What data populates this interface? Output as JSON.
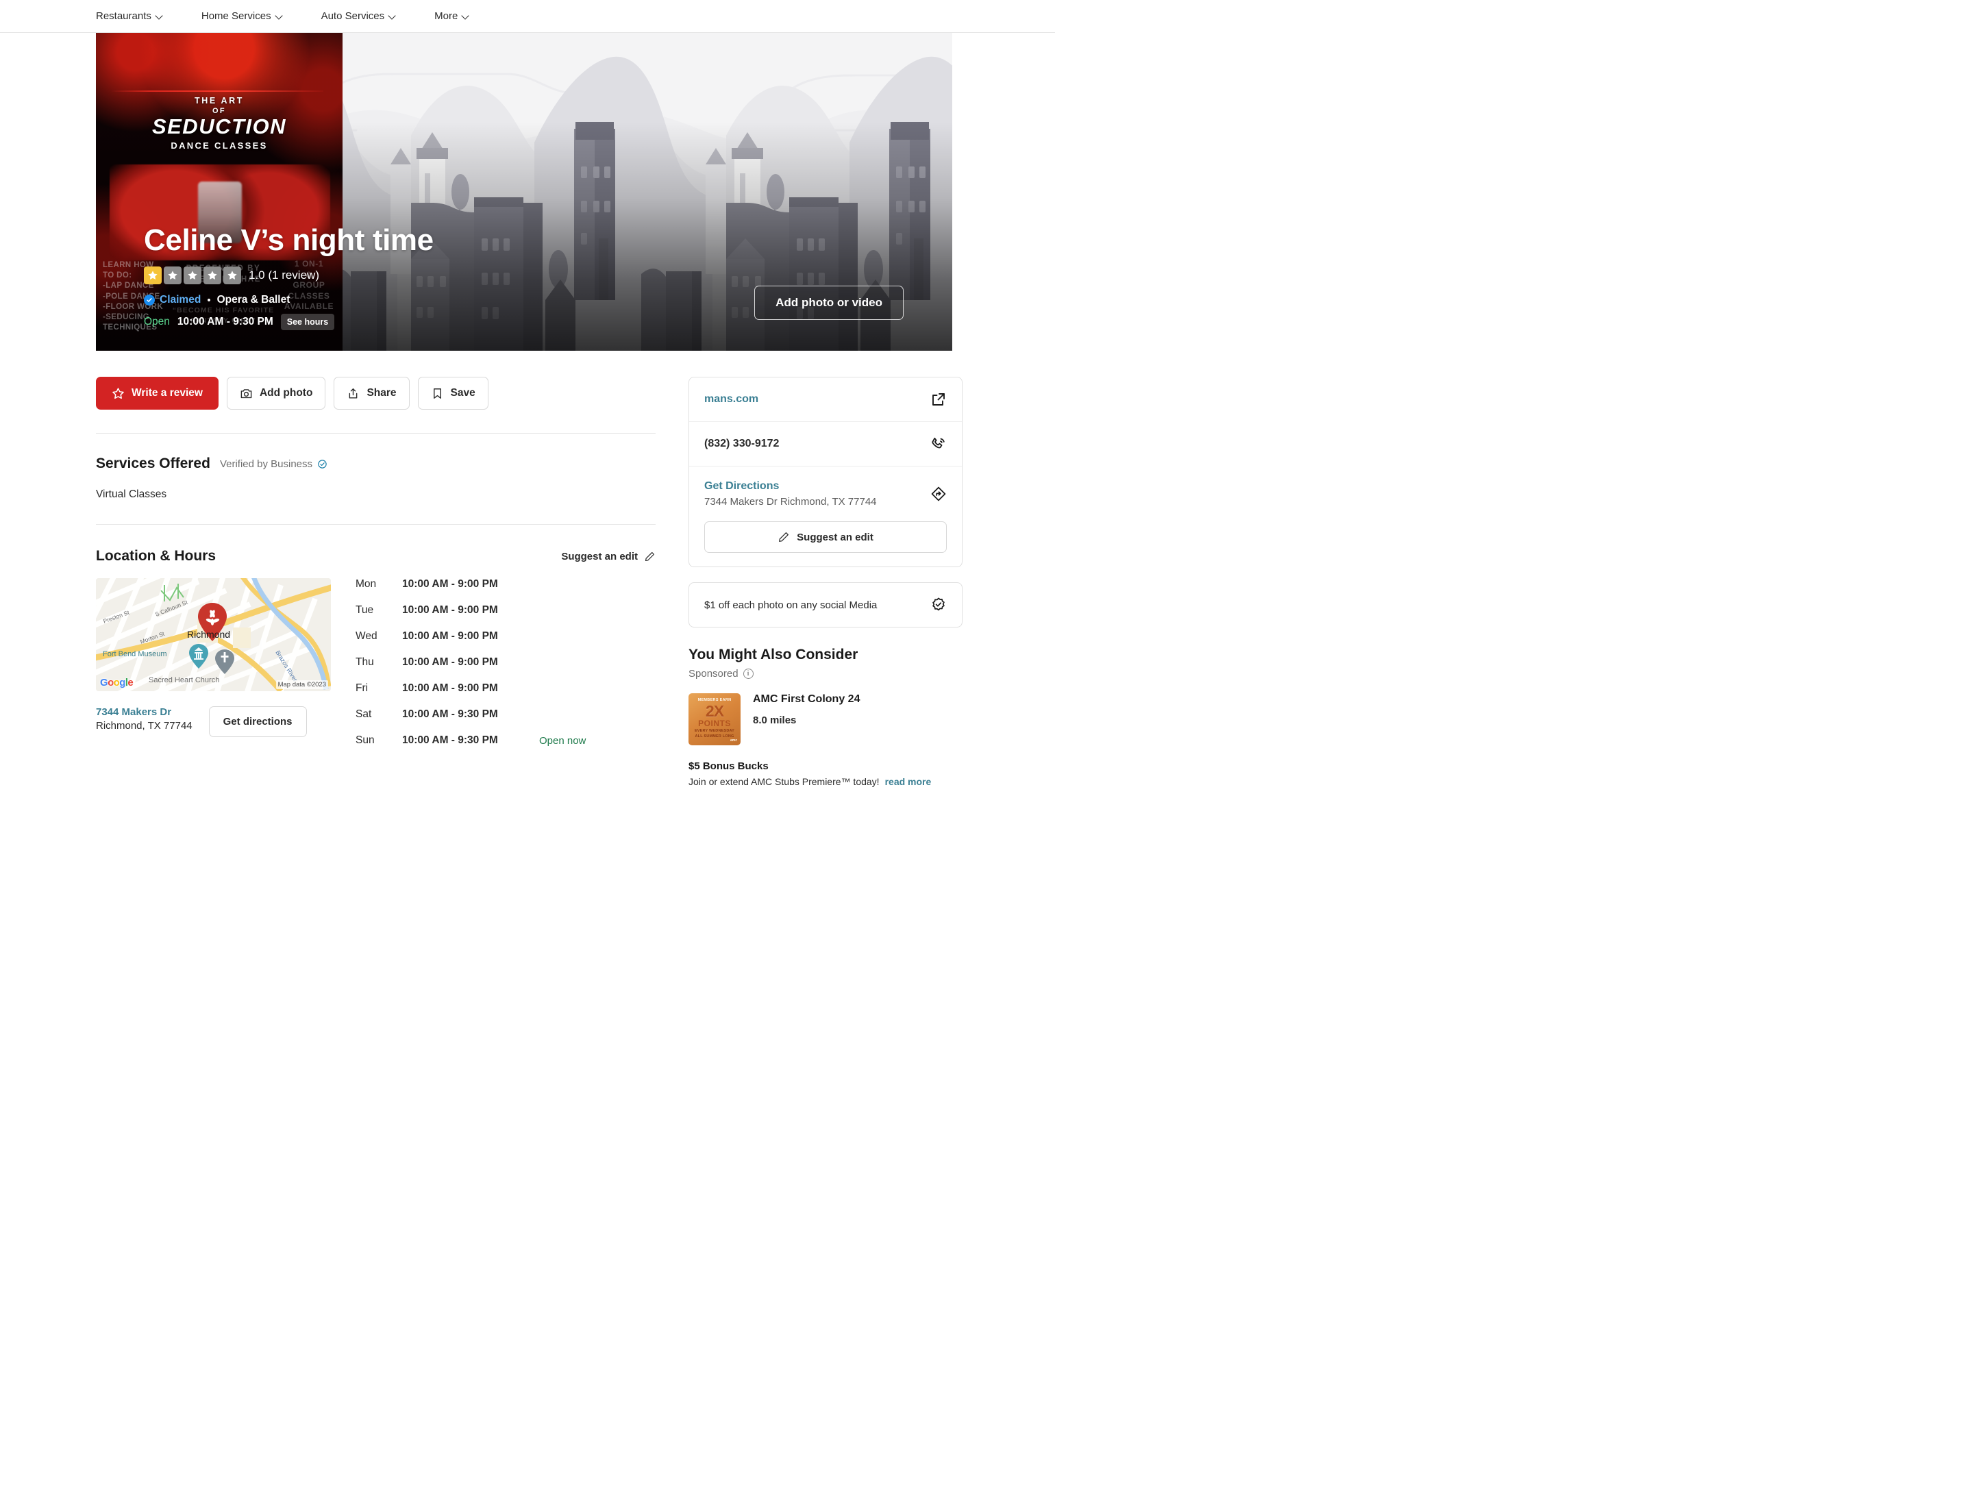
{
  "nav": {
    "items": [
      {
        "label": "Restaurants",
        "icon": "chevron-down-icon"
      },
      {
        "label": "Home Services",
        "icon": "chevron-down-icon"
      },
      {
        "label": "Auto Services",
        "icon": "chevron-down-icon"
      },
      {
        "label": "More",
        "icon": "chevron-down-icon"
      }
    ]
  },
  "hero": {
    "business_name": "Celine V’s night time",
    "rating_value": 1.0,
    "rating_stars_filled": 1,
    "rating_stars_total": 5,
    "rating_text": "1.0 (1 review)",
    "claimed_label": "Claimed",
    "separator": "•",
    "category": "Opera & Ballet",
    "open_label": "Open",
    "hours_today": "10:00 AM - 9:30 PM",
    "see_hours_label": "See hours",
    "add_photo_video_label": "Add photo or video",
    "accent_star_color": "#f5c33b",
    "claimed_color": "#60b0f4",
    "open_color": "#5bd68f",
    "poster": {
      "line1": "THE ART",
      "line2": "OF",
      "line3": "SEDUCTION",
      "line4": "DANCE CLASSES",
      "learn_how": "LEARN HOW\nTO DO:\n-LAP DANCE\n-POLE DANCE\n-FLOOR WORK\n-SEDUCING\nTECHNIQUES",
      "presented_by": "PRESENTED BY\nUNEEK LASHAE",
      "quote": "“BECOME HIS FAVORITE\nFANTASY GIRL”",
      "classes_note": "1 ON-1\n&\nGROUP\nCLASSES\nAVAILABLE"
    }
  },
  "actions": {
    "write_review": {
      "label": "Write a review",
      "icon": "star-outline-icon",
      "color": "#d32323"
    },
    "add_photo": {
      "label": "Add photo",
      "icon": "camera-icon"
    },
    "share": {
      "label": "Share",
      "icon": "share-icon"
    },
    "save": {
      "label": "Save",
      "icon": "bookmark-icon"
    }
  },
  "services": {
    "title": "Services Offered",
    "verified_label": "Verified by Business",
    "verified_icon": "check-circle-icon",
    "items": [
      "Virtual Classes"
    ]
  },
  "location": {
    "title": "Location & Hours",
    "suggest_edit_label": "Suggest an edit",
    "suggest_edit_icon": "pencil-icon",
    "map": {
      "city_label": "Richmond",
      "streets": [
        "Preston St",
        "S Calhoun St",
        "Morton St"
      ],
      "river_label": "Brazos River",
      "poi": [
        "Fort Bend Museum",
        "Sacred Heart Church"
      ],
      "provider": "Google",
      "attribution": "Map data ©2023",
      "marker_icon": "yelp-pin-icon"
    },
    "address_line1": "7344 Makers Dr",
    "address_line2": "Richmond, TX 77744",
    "get_directions_label": "Get directions",
    "hours": [
      {
        "day": "Mon",
        "time": "10:00 AM - 9:00 PM",
        "status": ""
      },
      {
        "day": "Tue",
        "time": "10:00 AM - 9:00 PM",
        "status": ""
      },
      {
        "day": "Wed",
        "time": "10:00 AM - 9:00 PM",
        "status": ""
      },
      {
        "day": "Thu",
        "time": "10:00 AM - 9:00 PM",
        "status": ""
      },
      {
        "day": "Fri",
        "time": "10:00 AM - 9:00 PM",
        "status": ""
      },
      {
        "day": "Sat",
        "time": "10:00 AM - 9:30 PM",
        "status": ""
      },
      {
        "day": "Sun",
        "time": "10:00 AM - 9:30 PM",
        "status": "Open now"
      }
    ]
  },
  "sidebar": {
    "website": "mans.com",
    "website_icon": "external-link-icon",
    "phone": "(832) 330-9172",
    "phone_icon": "phone-icon",
    "directions_label": "Get Directions",
    "directions_address": "7344 Makers Dr Richmond, TX 77744",
    "directions_icon": "directions-icon",
    "suggest_edit_label": "Suggest an edit",
    "suggest_edit_icon": "pencil-icon",
    "offer_text": "$1 off each photo on any social Media",
    "offer_icon": "badge-check-icon",
    "consider_title": "You Might Also Consider",
    "sponsored_label": "Sponsored",
    "sponsored_icon": "info-icon",
    "ad": {
      "name": "AMC First Colony 24",
      "distance": "8.0 miles",
      "offer_title": "$5 Bonus Bucks",
      "offer_desc": "Join or extend AMC Stubs Premiere™ today!",
      "read_more_label": "read more",
      "thumb": {
        "l1": "MEMBERS EARN",
        "l2": "2X",
        "l3": "POINTS",
        "l4": "EVERY WEDNESDAY",
        "l5": "ALL SUMMER LONG",
        "l6": "amc"
      }
    },
    "link_color": "#3a7f93"
  }
}
